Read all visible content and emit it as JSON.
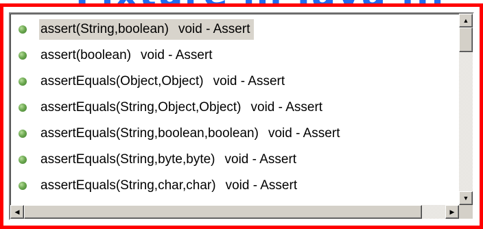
{
  "background_text": "Fixture in Java ...",
  "items": [
    {
      "signature": "assert(String,boolean)",
      "type": "void - Assert",
      "selected": true
    },
    {
      "signature": "assert(boolean)",
      "type": "void - Assert",
      "selected": false
    },
    {
      "signature": "assertEquals(Object,Object)",
      "type": "void - Assert",
      "selected": false
    },
    {
      "signature": "assertEquals(String,Object,Object)",
      "type": "void - Assert",
      "selected": false
    },
    {
      "signature": "assertEquals(String,boolean,boolean)",
      "type": "void - Assert",
      "selected": false
    },
    {
      "signature": "assertEquals(String,byte,byte)",
      "type": "void - Assert",
      "selected": false
    },
    {
      "signature": "assertEquals(String,char,char)",
      "type": "void - Assert",
      "selected": false
    }
  ],
  "icons": {
    "item_icon": "green-method-icon",
    "up": "arrow-up-icon",
    "down": "arrow-down-icon",
    "left": "arrow-left-icon",
    "right": "arrow-right-icon"
  },
  "glyphs": {
    "up": "▲",
    "down": "▼",
    "left": "◀",
    "right": "▶"
  },
  "colors": {
    "frame": "#ff0000",
    "background_text": "#1f6cf0",
    "selection": "#d8d4cc",
    "method_icon": "#6eaa52"
  }
}
